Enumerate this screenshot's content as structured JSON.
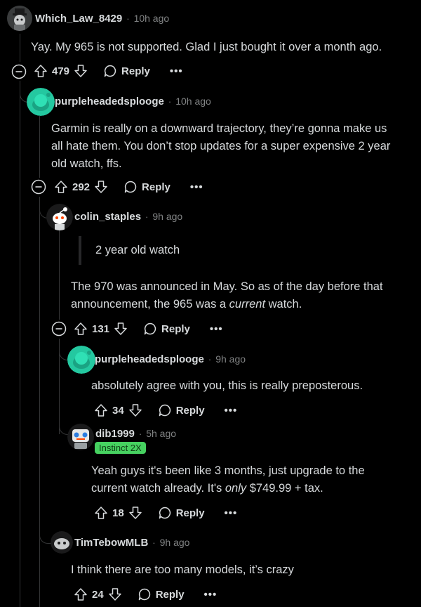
{
  "comments": [
    {
      "username": "Which_Law_8429",
      "time": "10h ago",
      "body": "Yay. My 965 is not supported. Glad I just bought it over a month ago.",
      "votes": "479",
      "reply_label": "Reply",
      "more_label": "•••"
    },
    {
      "username": "purpleheadedsplooge",
      "time": "10h ago",
      "body_lines": [
        "Garmin is really on a downward trajectory, they’re gonna make us",
        "all hate them. You don’t stop updates for a super expensive 2 year",
        "old watch, ffs."
      ],
      "votes": "292",
      "reply_label": "Reply",
      "more_label": "•••"
    },
    {
      "username": "colin_staples",
      "time": "9h ago",
      "quote": "2 year old watch",
      "body_line1": "The 970 was announced in May. So as of the day before that",
      "body_line2_a": "announcement, the 965 was a ",
      "body_line2_em": "current",
      "body_line2_b": " watch.",
      "votes": "131",
      "reply_label": "Reply",
      "more_label": "•••"
    },
    {
      "username": "purpleheadedsplooge",
      "time": "9h ago",
      "body": "absolutely agree with you, this is really preposterous.",
      "votes": "34",
      "reply_label": "Reply",
      "more_label": "•••"
    },
    {
      "username": "dib1999",
      "time": "5h ago",
      "flair": "Instinct 2X",
      "body_line1": "Yeah guys it's been like 3 months, just upgrade to the",
      "body_line2_a": "current watch already. It's ",
      "body_line2_em": "only",
      "body_line2_b": " $749.99 + tax.",
      "votes": "18",
      "reply_label": "Reply",
      "more_label": "•••"
    },
    {
      "username": "TimTebowMLB",
      "time": "9h ago",
      "body": "I think there are too many models, it’s crazy",
      "votes": "24",
      "reply_label": "Reply",
      "more_label": "•••"
    }
  ],
  "separator": "·",
  "colors": {
    "background": "#000000",
    "text": "#d7dadc",
    "meta": "#818384",
    "thread_line": "#343536",
    "flair_bg": "#46d160",
    "avatar_teal": "#24c8a0"
  }
}
